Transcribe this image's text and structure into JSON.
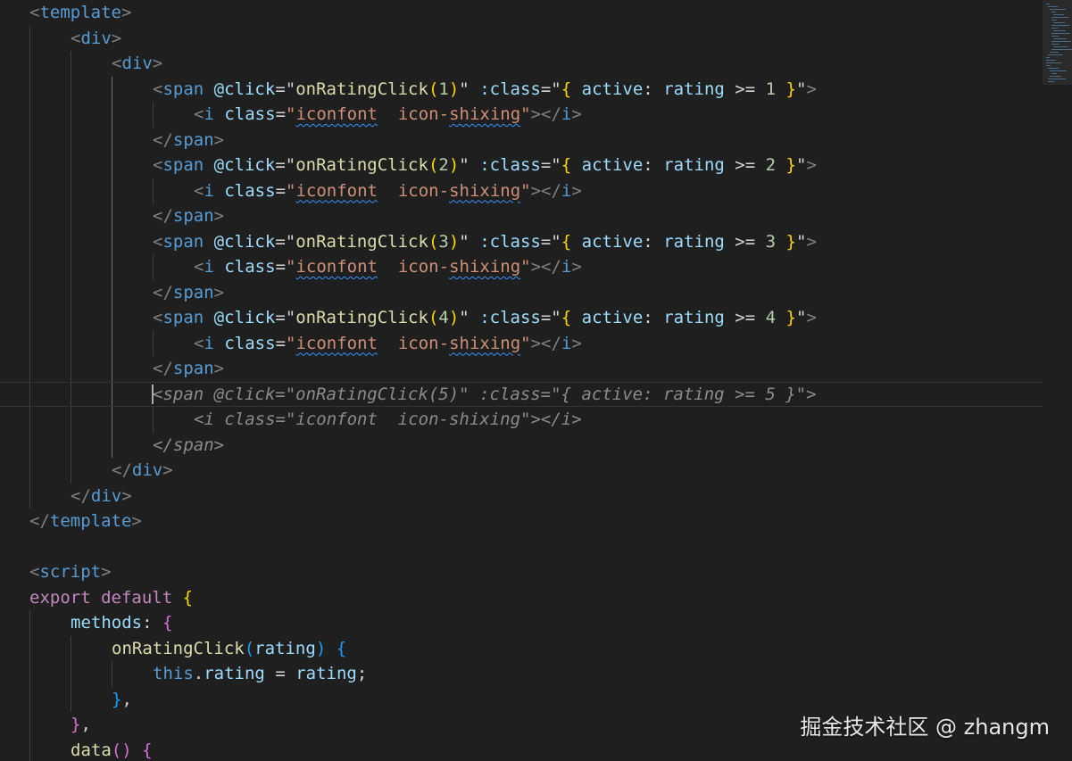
{
  "editor": {
    "language": "vue",
    "lines": [
      {
        "indent": 0,
        "tokens": [
          [
            "<",
            "t-punct"
          ],
          [
            "template",
            "t-tag"
          ],
          [
            ">",
            "t-punct"
          ]
        ]
      },
      {
        "indent": 1,
        "tokens": [
          [
            "<",
            "t-punct"
          ],
          [
            "div",
            "t-tag"
          ],
          [
            ">",
            "t-punct"
          ]
        ]
      },
      {
        "indent": 2,
        "tokens": [
          [
            "<",
            "t-punct"
          ],
          [
            "div",
            "t-tag"
          ],
          [
            ">",
            "t-punct"
          ]
        ]
      },
      {
        "indent": 3,
        "tokens": [
          [
            "<",
            "t-punct"
          ],
          [
            "span",
            "t-tag"
          ],
          [
            " ",
            "t-plain"
          ],
          [
            "@click",
            "t-attr"
          ],
          [
            "=",
            "t-plain"
          ],
          [
            "\"",
            "t-str2"
          ],
          [
            "onRatingClick",
            "t-fn"
          ],
          [
            "(",
            "t-b1"
          ],
          [
            "1",
            "t-num"
          ],
          [
            ")",
            "t-b1"
          ],
          [
            "\"",
            "t-str2"
          ],
          [
            " ",
            "t-plain"
          ],
          [
            ":class",
            "t-attr"
          ],
          [
            "=",
            "t-plain"
          ],
          [
            "\"",
            "t-str2"
          ],
          [
            "{",
            "t-b1"
          ],
          [
            " ",
            "t-plain"
          ],
          [
            "active",
            "t-attr"
          ],
          [
            ":",
            "t-plain"
          ],
          [
            " ",
            "t-plain"
          ],
          [
            "rating",
            "t-var"
          ],
          [
            " ",
            "t-plain"
          ],
          [
            ">=",
            "t-op"
          ],
          [
            " ",
            "t-plain"
          ],
          [
            "1",
            "t-num"
          ],
          [
            " ",
            "t-plain"
          ],
          [
            "}",
            "t-b1"
          ],
          [
            "\"",
            "t-str2"
          ],
          [
            ">",
            "t-punct"
          ]
        ]
      },
      {
        "indent": 4,
        "tokens": [
          [
            "<",
            "t-punct"
          ],
          [
            "i",
            "t-tag"
          ],
          [
            " ",
            "t-plain"
          ],
          [
            "class",
            "t-attr"
          ],
          [
            "=",
            "t-plain"
          ],
          [
            "\"",
            "t-str"
          ],
          [
            "iconfont",
            "t-str squig"
          ],
          [
            "  icon-",
            "t-str"
          ],
          [
            "shixing",
            "t-str squig"
          ],
          [
            "\"",
            "t-str"
          ],
          [
            "></",
            "t-punct"
          ],
          [
            "i",
            "t-tag"
          ],
          [
            ">",
            "t-punct"
          ]
        ]
      },
      {
        "indent": 3,
        "tokens": [
          [
            "</",
            "t-punct"
          ],
          [
            "span",
            "t-tag"
          ],
          [
            ">",
            "t-punct"
          ]
        ]
      },
      {
        "indent": 3,
        "tokens": [
          [
            "<",
            "t-punct"
          ],
          [
            "span",
            "t-tag"
          ],
          [
            " ",
            "t-plain"
          ],
          [
            "@click",
            "t-attr"
          ],
          [
            "=",
            "t-plain"
          ],
          [
            "\"",
            "t-str2"
          ],
          [
            "onRatingClick",
            "t-fn"
          ],
          [
            "(",
            "t-b1"
          ],
          [
            "2",
            "t-num"
          ],
          [
            ")",
            "t-b1"
          ],
          [
            "\"",
            "t-str2"
          ],
          [
            " ",
            "t-plain"
          ],
          [
            ":class",
            "t-attr"
          ],
          [
            "=",
            "t-plain"
          ],
          [
            "\"",
            "t-str2"
          ],
          [
            "{",
            "t-b1"
          ],
          [
            " ",
            "t-plain"
          ],
          [
            "active",
            "t-attr"
          ],
          [
            ":",
            "t-plain"
          ],
          [
            " ",
            "t-plain"
          ],
          [
            "rating",
            "t-var"
          ],
          [
            " ",
            "t-plain"
          ],
          [
            ">=",
            "t-op"
          ],
          [
            " ",
            "t-plain"
          ],
          [
            "2",
            "t-num"
          ],
          [
            " ",
            "t-plain"
          ],
          [
            "}",
            "t-b1"
          ],
          [
            "\"",
            "t-str2"
          ],
          [
            ">",
            "t-punct"
          ]
        ]
      },
      {
        "indent": 4,
        "tokens": [
          [
            "<",
            "t-punct"
          ],
          [
            "i",
            "t-tag"
          ],
          [
            " ",
            "t-plain"
          ],
          [
            "class",
            "t-attr"
          ],
          [
            "=",
            "t-plain"
          ],
          [
            "\"",
            "t-str"
          ],
          [
            "iconfont",
            "t-str squig"
          ],
          [
            "  icon-",
            "t-str"
          ],
          [
            "shixing",
            "t-str squig"
          ],
          [
            "\"",
            "t-str"
          ],
          [
            "></",
            "t-punct"
          ],
          [
            "i",
            "t-tag"
          ],
          [
            ">",
            "t-punct"
          ]
        ]
      },
      {
        "indent": 3,
        "tokens": [
          [
            "</",
            "t-punct"
          ],
          [
            "span",
            "t-tag"
          ],
          [
            ">",
            "t-punct"
          ]
        ]
      },
      {
        "indent": 3,
        "tokens": [
          [
            "<",
            "t-punct"
          ],
          [
            "span",
            "t-tag"
          ],
          [
            " ",
            "t-plain"
          ],
          [
            "@click",
            "t-attr"
          ],
          [
            "=",
            "t-plain"
          ],
          [
            "\"",
            "t-str2"
          ],
          [
            "onRatingClick",
            "t-fn"
          ],
          [
            "(",
            "t-b1"
          ],
          [
            "3",
            "t-num"
          ],
          [
            ")",
            "t-b1"
          ],
          [
            "\"",
            "t-str2"
          ],
          [
            " ",
            "t-plain"
          ],
          [
            ":class",
            "t-attr"
          ],
          [
            "=",
            "t-plain"
          ],
          [
            "\"",
            "t-str2"
          ],
          [
            "{",
            "t-b1"
          ],
          [
            " ",
            "t-plain"
          ],
          [
            "active",
            "t-attr"
          ],
          [
            ":",
            "t-plain"
          ],
          [
            " ",
            "t-plain"
          ],
          [
            "rating",
            "t-var"
          ],
          [
            " ",
            "t-plain"
          ],
          [
            ">=",
            "t-op"
          ],
          [
            " ",
            "t-plain"
          ],
          [
            "3",
            "t-num"
          ],
          [
            " ",
            "t-plain"
          ],
          [
            "}",
            "t-b1"
          ],
          [
            "\"",
            "t-str2"
          ],
          [
            ">",
            "t-punct"
          ]
        ]
      },
      {
        "indent": 4,
        "tokens": [
          [
            "<",
            "t-punct"
          ],
          [
            "i",
            "t-tag"
          ],
          [
            " ",
            "t-plain"
          ],
          [
            "class",
            "t-attr"
          ],
          [
            "=",
            "t-plain"
          ],
          [
            "\"",
            "t-str"
          ],
          [
            "iconfont",
            "t-str squig"
          ],
          [
            "  icon-",
            "t-str"
          ],
          [
            "shixing",
            "t-str squig"
          ],
          [
            "\"",
            "t-str"
          ],
          [
            "></",
            "t-punct"
          ],
          [
            "i",
            "t-tag"
          ],
          [
            ">",
            "t-punct"
          ]
        ]
      },
      {
        "indent": 3,
        "tokens": [
          [
            "</",
            "t-punct"
          ],
          [
            "span",
            "t-tag"
          ],
          [
            ">",
            "t-punct"
          ]
        ]
      },
      {
        "indent": 3,
        "tokens": [
          [
            "<",
            "t-punct"
          ],
          [
            "span",
            "t-tag"
          ],
          [
            " ",
            "t-plain"
          ],
          [
            "@click",
            "t-attr"
          ],
          [
            "=",
            "t-plain"
          ],
          [
            "\"",
            "t-str2"
          ],
          [
            "onRatingClick",
            "t-fn"
          ],
          [
            "(",
            "t-b1"
          ],
          [
            "4",
            "t-num"
          ],
          [
            ")",
            "t-b1"
          ],
          [
            "\"",
            "t-str2"
          ],
          [
            " ",
            "t-plain"
          ],
          [
            ":class",
            "t-attr"
          ],
          [
            "=",
            "t-plain"
          ],
          [
            "\"",
            "t-str2"
          ],
          [
            "{",
            "t-b1"
          ],
          [
            " ",
            "t-plain"
          ],
          [
            "active",
            "t-attr"
          ],
          [
            ":",
            "t-plain"
          ],
          [
            " ",
            "t-plain"
          ],
          [
            "rating",
            "t-var"
          ],
          [
            " ",
            "t-plain"
          ],
          [
            ">=",
            "t-op"
          ],
          [
            " ",
            "t-plain"
          ],
          [
            "4",
            "t-num"
          ],
          [
            " ",
            "t-plain"
          ],
          [
            "}",
            "t-b1"
          ],
          [
            "\"",
            "t-str2"
          ],
          [
            ">",
            "t-punct"
          ]
        ]
      },
      {
        "indent": 4,
        "tokens": [
          [
            "<",
            "t-punct"
          ],
          [
            "i",
            "t-tag"
          ],
          [
            " ",
            "t-plain"
          ],
          [
            "class",
            "t-attr"
          ],
          [
            "=",
            "t-plain"
          ],
          [
            "\"",
            "t-str"
          ],
          [
            "iconfont",
            "t-str squig"
          ],
          [
            "  icon-",
            "t-str"
          ],
          [
            "shixing",
            "t-str squig"
          ],
          [
            "\"",
            "t-str"
          ],
          [
            "></",
            "t-punct"
          ],
          [
            "i",
            "t-tag"
          ],
          [
            ">",
            "t-punct"
          ]
        ]
      },
      {
        "indent": 3,
        "tokens": [
          [
            "</",
            "t-punct"
          ],
          [
            "span",
            "t-tag"
          ],
          [
            ">",
            "t-punct"
          ]
        ]
      },
      {
        "indent": 3,
        "current": true,
        "cursor": true,
        "tokens": [
          [
            "<span @click=\"onRatingClick(5)\" :class=\"{ active: rating >= 5 }\">",
            "ghost"
          ]
        ]
      },
      {
        "indent": 4,
        "tokens": [
          [
            "<i class=\"iconfont  icon-shixing\"></i>",
            "ghost"
          ]
        ]
      },
      {
        "indent": 3,
        "tokens": [
          [
            "</span>",
            "ghost"
          ]
        ]
      },
      {
        "indent": 2,
        "tokens": [
          [
            "</",
            "t-punct"
          ],
          [
            "div",
            "t-tag"
          ],
          [
            ">",
            "t-punct"
          ]
        ]
      },
      {
        "indent": 1,
        "tokens": [
          [
            "</",
            "t-punct"
          ],
          [
            "div",
            "t-tag"
          ],
          [
            ">",
            "t-punct"
          ]
        ]
      },
      {
        "indent": 0,
        "tokens": [
          [
            "</",
            "t-punct"
          ],
          [
            "template",
            "t-tag"
          ],
          [
            ">",
            "t-punct"
          ]
        ]
      },
      {
        "indent": 0,
        "tokens": []
      },
      {
        "indent": 0,
        "tokens": [
          [
            "<",
            "t-punct"
          ],
          [
            "script",
            "t-tag"
          ],
          [
            ">",
            "t-punct"
          ]
        ]
      },
      {
        "indent": 0,
        "tokens": [
          [
            "export",
            "t-kw"
          ],
          [
            " ",
            "t-plain"
          ],
          [
            "default",
            "t-kw"
          ],
          [
            " ",
            "t-plain"
          ],
          [
            "{",
            "t-b1"
          ]
        ]
      },
      {
        "indent": 1,
        "tokens": [
          [
            "methods",
            "t-attr"
          ],
          [
            ":",
            "t-plain"
          ],
          [
            " ",
            "t-plain"
          ],
          [
            "{",
            "t-b2"
          ]
        ]
      },
      {
        "indent": 2,
        "tokens": [
          [
            "onRatingClick",
            "t-fn"
          ],
          [
            "(",
            "t-b3"
          ],
          [
            "rating",
            "t-var"
          ],
          [
            ")",
            "t-b3"
          ],
          [
            " ",
            "t-plain"
          ],
          [
            "{",
            "t-b3"
          ]
        ]
      },
      {
        "indent": 3,
        "tokens": [
          [
            "this",
            "t-this"
          ],
          [
            ".",
            "t-plain"
          ],
          [
            "rating",
            "t-var"
          ],
          [
            " ",
            "t-plain"
          ],
          [
            "=",
            "t-op"
          ],
          [
            " ",
            "t-plain"
          ],
          [
            "rating",
            "t-var"
          ],
          [
            ";",
            "t-plain"
          ]
        ]
      },
      {
        "indent": 2,
        "tokens": [
          [
            "}",
            "t-b3"
          ],
          [
            ",",
            "t-plain"
          ]
        ]
      },
      {
        "indent": 1,
        "tokens": [
          [
            "}",
            "t-b2"
          ],
          [
            ",",
            "t-plain"
          ]
        ]
      },
      {
        "indent": 1,
        "tokens": [
          [
            "data",
            "t-fn"
          ],
          [
            "(",
            "t-b2"
          ],
          [
            ")",
            "t-b2"
          ],
          [
            " ",
            "t-plain"
          ],
          [
            "{",
            "t-b2"
          ]
        ]
      }
    ]
  },
  "watermark": "掘金技术社区 @ zhangm"
}
